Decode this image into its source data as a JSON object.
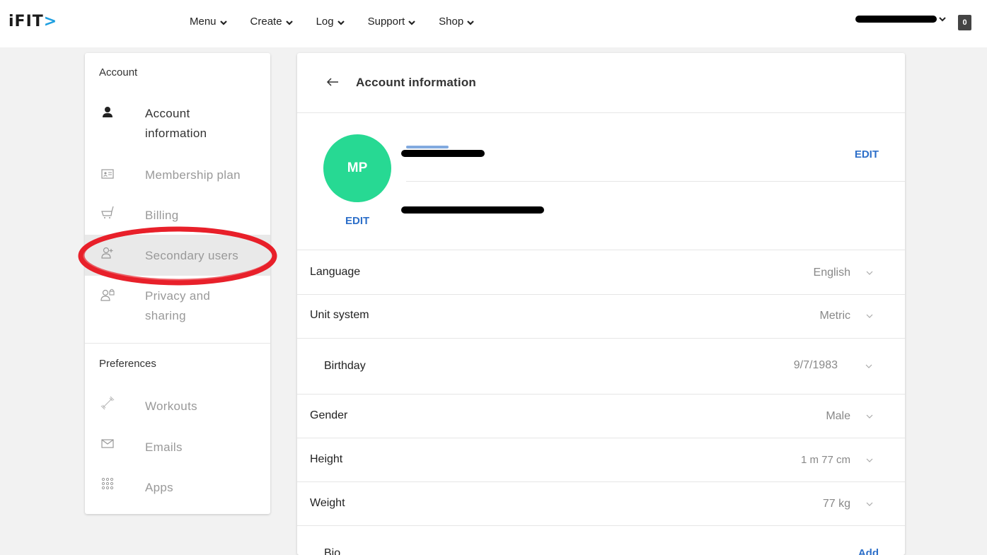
{
  "brand": {
    "logo_text": "iFIT",
    "logo_mark": ">"
  },
  "nav": {
    "items": [
      {
        "label": "Menu"
      },
      {
        "label": "Create"
      },
      {
        "label": "Log"
      },
      {
        "label": "Support"
      },
      {
        "label": "Shop"
      }
    ],
    "cart_count": "0"
  },
  "sidebar": {
    "account_title": "Account",
    "account_items": [
      {
        "label_line1": "Account",
        "label_line2": "information",
        "icon": "user-icon"
      },
      {
        "label": "Membership plan",
        "icon": "id-card-icon"
      },
      {
        "label": "Billing",
        "icon": "cart-icon"
      },
      {
        "label": "Secondary users",
        "icon": "add-user-icon"
      },
      {
        "label_line1": "Privacy and",
        "label_line2": "sharing",
        "icon": "user-lock-icon"
      }
    ],
    "preferences_title": "Preferences",
    "preference_items": [
      {
        "label": "Workouts",
        "icon": "dumbbell-icon"
      },
      {
        "label": "Emails",
        "icon": "envelope-icon"
      },
      {
        "label": "Apps",
        "icon": "grid-icon"
      }
    ]
  },
  "main": {
    "title": "Account information",
    "profile": {
      "initials": "MP",
      "avatar_color": "#27d993",
      "avatar_edit": "EDIT",
      "edit": "EDIT"
    },
    "rows": [
      {
        "label": "Language",
        "value": "English"
      },
      {
        "label": "Unit system",
        "value": "Metric"
      },
      {
        "label": "Birthday",
        "value": "9/7/1983"
      },
      {
        "label": "Gender",
        "value": "Male"
      },
      {
        "label": "Height",
        "value": "1 m 77 cm"
      },
      {
        "label": "Weight",
        "value": "77 kg"
      },
      {
        "label": "Bio",
        "action": "Add"
      }
    ]
  },
  "colors": {
    "accent": "#2d6fc9",
    "brand_blue": "#1e9fe0",
    "annotation": "#e8202a"
  }
}
